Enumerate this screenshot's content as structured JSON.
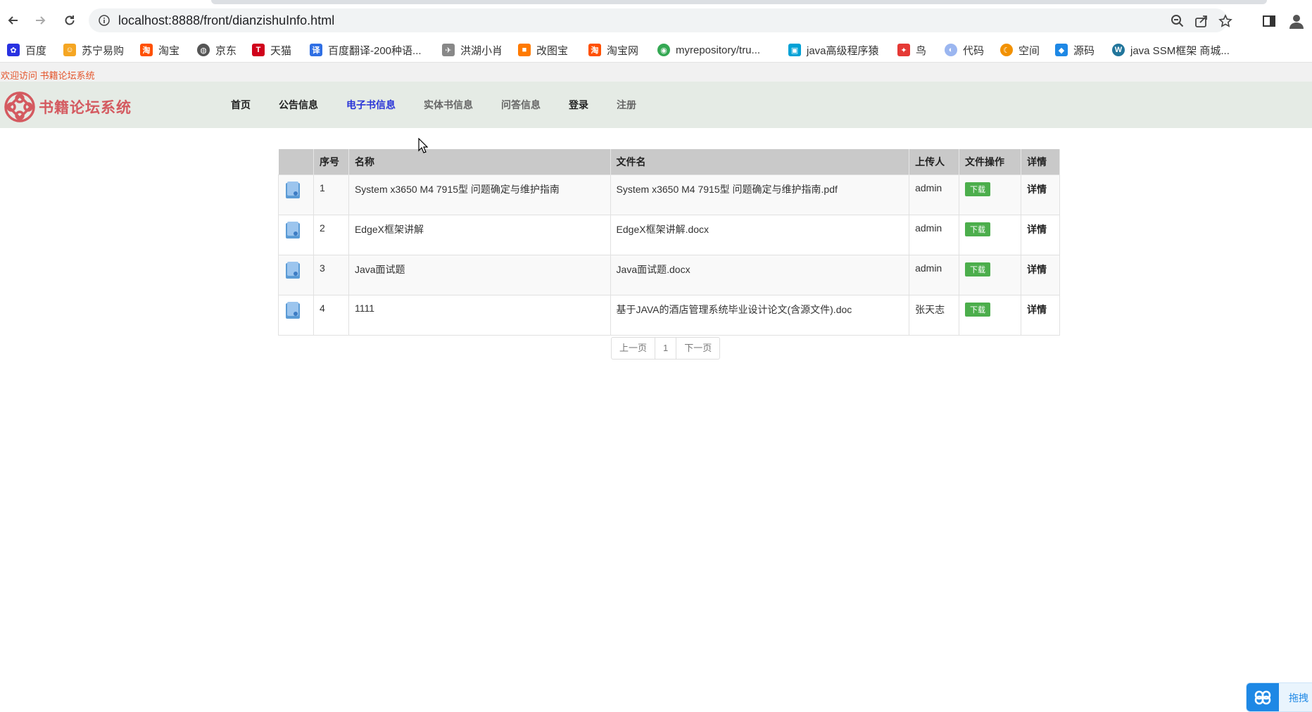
{
  "browser": {
    "url": "localhost:8888/front/dianzishuInfo.html",
    "bookmarks": [
      {
        "label": "百度",
        "icon": "baidu-icon",
        "color": "#2932e1"
      },
      {
        "label": "苏宁易购",
        "icon": "suning-icon",
        "color": "#f5a623"
      },
      {
        "label": "淘宝",
        "icon": "taobao-icon",
        "color": "#ff5000"
      },
      {
        "label": "京东",
        "icon": "globe-icon",
        "color": "#555555"
      },
      {
        "label": "天猫",
        "icon": "tmall-icon",
        "color": "#d0021b"
      },
      {
        "label": "百度翻译-200种语...",
        "icon": "translate-icon",
        "color": "#2f6fe4"
      },
      {
        "label": "洪湖小肖",
        "icon": "bird-icon",
        "color": "#888888"
      },
      {
        "label": "改图宝",
        "icon": "gaitubao-icon",
        "color": "#ff7a00"
      },
      {
        "label": "淘宝网",
        "icon": "taobao-icon",
        "color": "#ff5000"
      },
      {
        "label": "myrepository/tru...",
        "icon": "chrome-icon",
        "color": "#34a853"
      },
      {
        "label": "java高级程序猿",
        "icon": "bilibili-icon",
        "color": "#00a1d6"
      },
      {
        "label": "鸟",
        "icon": "bird-icon",
        "color": "#e53935"
      },
      {
        "label": "代码",
        "icon": "code-icon",
        "color": "#9bb6f0"
      },
      {
        "label": "空间",
        "icon": "space-icon",
        "color": "#f29100"
      },
      {
        "label": "源码",
        "icon": "fish-icon",
        "color": "#1e88e5"
      },
      {
        "label": "java SSM框架 商城...",
        "icon": "wordpress-icon",
        "color": "#21759b"
      }
    ]
  },
  "site": {
    "welcome": "欢迎访问 书籍论坛系统",
    "logo_text": "书籍论坛系统",
    "nav": [
      "首页",
      "公告信息",
      "电子书信息",
      "实体书信息",
      "问答信息",
      "登录",
      "注册"
    ]
  },
  "table": {
    "headers": [
      "",
      "序号",
      "名称",
      "文件名",
      "上传人",
      "文件操作",
      "详情"
    ],
    "rows": [
      {
        "no": "1",
        "name": "System x3650 M4 7915型 问题确定与维护指南",
        "file": "System x3650 M4 7915型 问题确定与维护指南.pdf",
        "uploader": "admin",
        "action": "下载",
        "detail": "详情"
      },
      {
        "no": "2",
        "name": "EdgeX框架讲解",
        "file": "EdgeX框架讲解.docx",
        "uploader": "admin",
        "action": "下载",
        "detail": "详情"
      },
      {
        "no": "3",
        "name": "Java面试题",
        "file": "Java面试题.docx",
        "uploader": "admin",
        "action": "下载",
        "detail": "详情"
      },
      {
        "no": "4",
        "name": "1111",
        "file": "基于JAVA的酒店管理系统毕业设计论文(含源文件).doc",
        "uploader": "张天志",
        "action": "下载",
        "detail": "详情"
      }
    ]
  },
  "pager": {
    "prev": "上一页",
    "page": "1",
    "next": "下一页"
  },
  "widget": {
    "label": "拖拽"
  }
}
